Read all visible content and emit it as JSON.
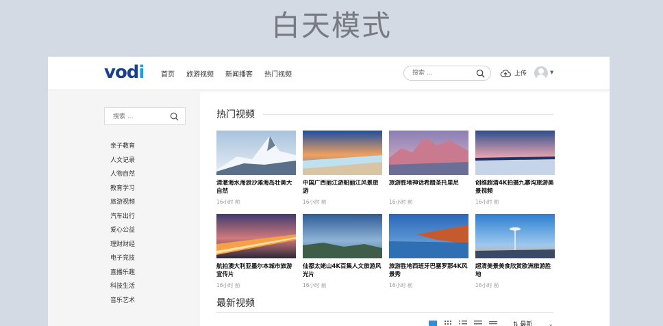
{
  "banner": {
    "title": "白天模式"
  },
  "header": {
    "logo": {
      "main": "vod",
      "accent": "i"
    },
    "nav": [
      "首页",
      "旅游视频",
      "新闻播客",
      "热门视频"
    ],
    "search": {
      "placeholder": "搜索 ..."
    },
    "upload_label": "上传"
  },
  "sidebar": {
    "search": {
      "placeholder": "搜索 ..."
    },
    "categories": [
      "亲子教育",
      "人文记录",
      "人物自然",
      "教育学习",
      "旅游视频",
      "汽车出行",
      "爱心公益",
      "理财财经",
      "电子竞技",
      "直播乐趣",
      "科技生活",
      "音乐艺术"
    ]
  },
  "main": {
    "hot_title": "热门视频",
    "latest_title": "最新视频",
    "videos": [
      {
        "title": "清澈海水海浪沙滩海岛壮美大自然",
        "time": "16小时 前"
      },
      {
        "title": "中国广西丽江游船丽江风景旅游",
        "time": "16小时 前"
      },
      {
        "title": "旅游胜地神话希腊圣托里尼",
        "time": "16小时 前"
      },
      {
        "title": "创维超清4K拍摄九寨沟旅游美景视频",
        "time": "16小时 前"
      },
      {
        "title": "航拍澳大利亚墨尔本城市旅游宣传片",
        "time": "16小时 前"
      },
      {
        "title": "仙都太姥山4K百集人文旅游风光片",
        "time": "16小时 前"
      },
      {
        "title": "旅游胜地西班牙巴塞罗那4K风景秀",
        "time": "16小时 前"
      },
      {
        "title": "超清美景美食欣赏欧洲旅游胜地",
        "time": "16小时 前"
      }
    ],
    "sort_label": "最新",
    "active_color": "#2b8fe0"
  }
}
